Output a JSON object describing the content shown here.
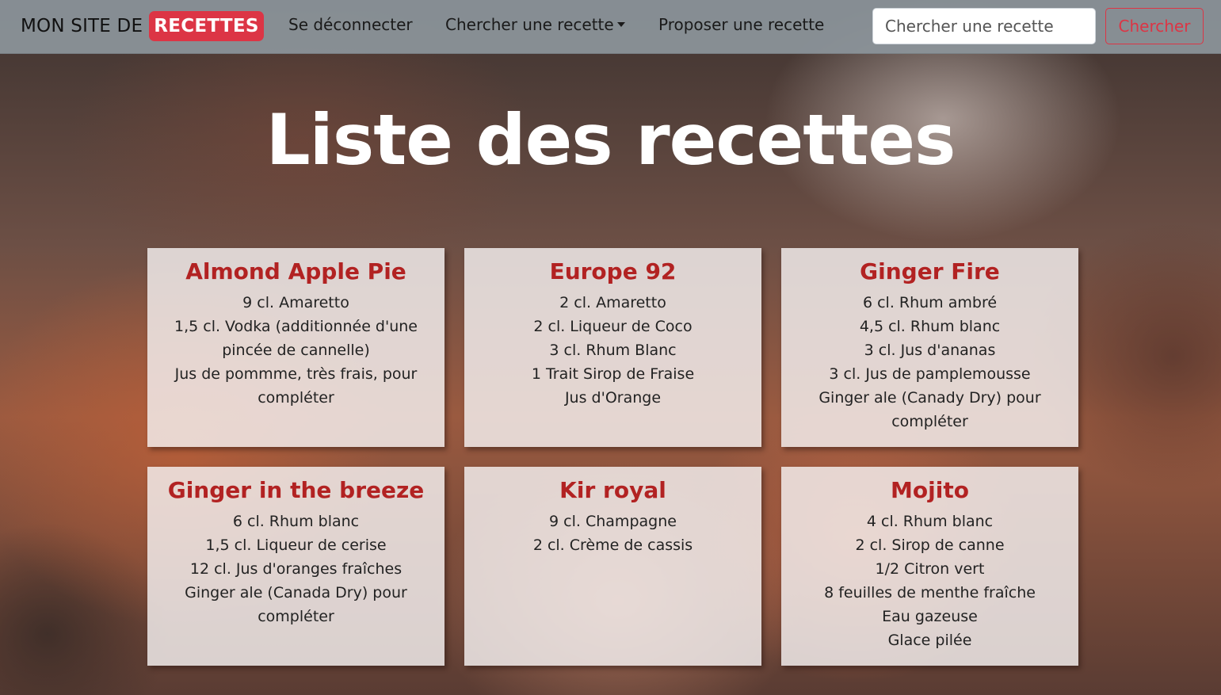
{
  "navbar": {
    "brand_prefix": "MON SITE DE",
    "brand_badge": "RECETTES",
    "links": {
      "logout": "Se déconnecter",
      "search_dropdown": "Chercher une recette",
      "propose": "Proposer une recette"
    },
    "search": {
      "placeholder": "Chercher une recette",
      "button": "Chercher"
    }
  },
  "page": {
    "title": "Liste des recettes"
  },
  "colors": {
    "accent": "#dc3545",
    "card_title": "#b22222"
  },
  "recipes": [
    {
      "title": "Almond Apple Pie",
      "ingredients": [
        "9 cl. Amaretto",
        "1,5 cl. Vodka (additionnée d'une pincée de cannelle)",
        "Jus de pommme, très frais, pour compléter"
      ]
    },
    {
      "title": "Europe 92",
      "ingredients": [
        "2 cl. Amaretto",
        "2 cl. Liqueur de Coco",
        "3 cl. Rhum Blanc",
        "1 Trait Sirop de Fraise",
        "Jus d'Orange"
      ]
    },
    {
      "title": "Ginger Fire",
      "ingredients": [
        "6 cl. Rhum ambré",
        "4,5 cl. Rhum blanc",
        "3 cl. Jus d'ananas",
        "3 cl. Jus de pamplemousse",
        "Ginger ale (Canady Dry) pour compléter"
      ]
    },
    {
      "title": "Ginger in the breeze",
      "ingredients": [
        "6 cl. Rhum blanc",
        "1,5 cl. Liqueur de cerise",
        "12 cl. Jus d'oranges fraîches",
        "Ginger ale (Canada Dry) pour compléter"
      ]
    },
    {
      "title": "Kir royal",
      "ingredients": [
        "9 cl. Champagne",
        "2 cl. Crème de cassis"
      ]
    },
    {
      "title": "Mojito",
      "ingredients": [
        "4 cl. Rhum blanc",
        "2 cl. Sirop de canne",
        "1/2 Citron vert",
        "8 feuilles de menthe fraîche",
        "Eau gazeuse",
        "Glace pilée"
      ]
    }
  ]
}
